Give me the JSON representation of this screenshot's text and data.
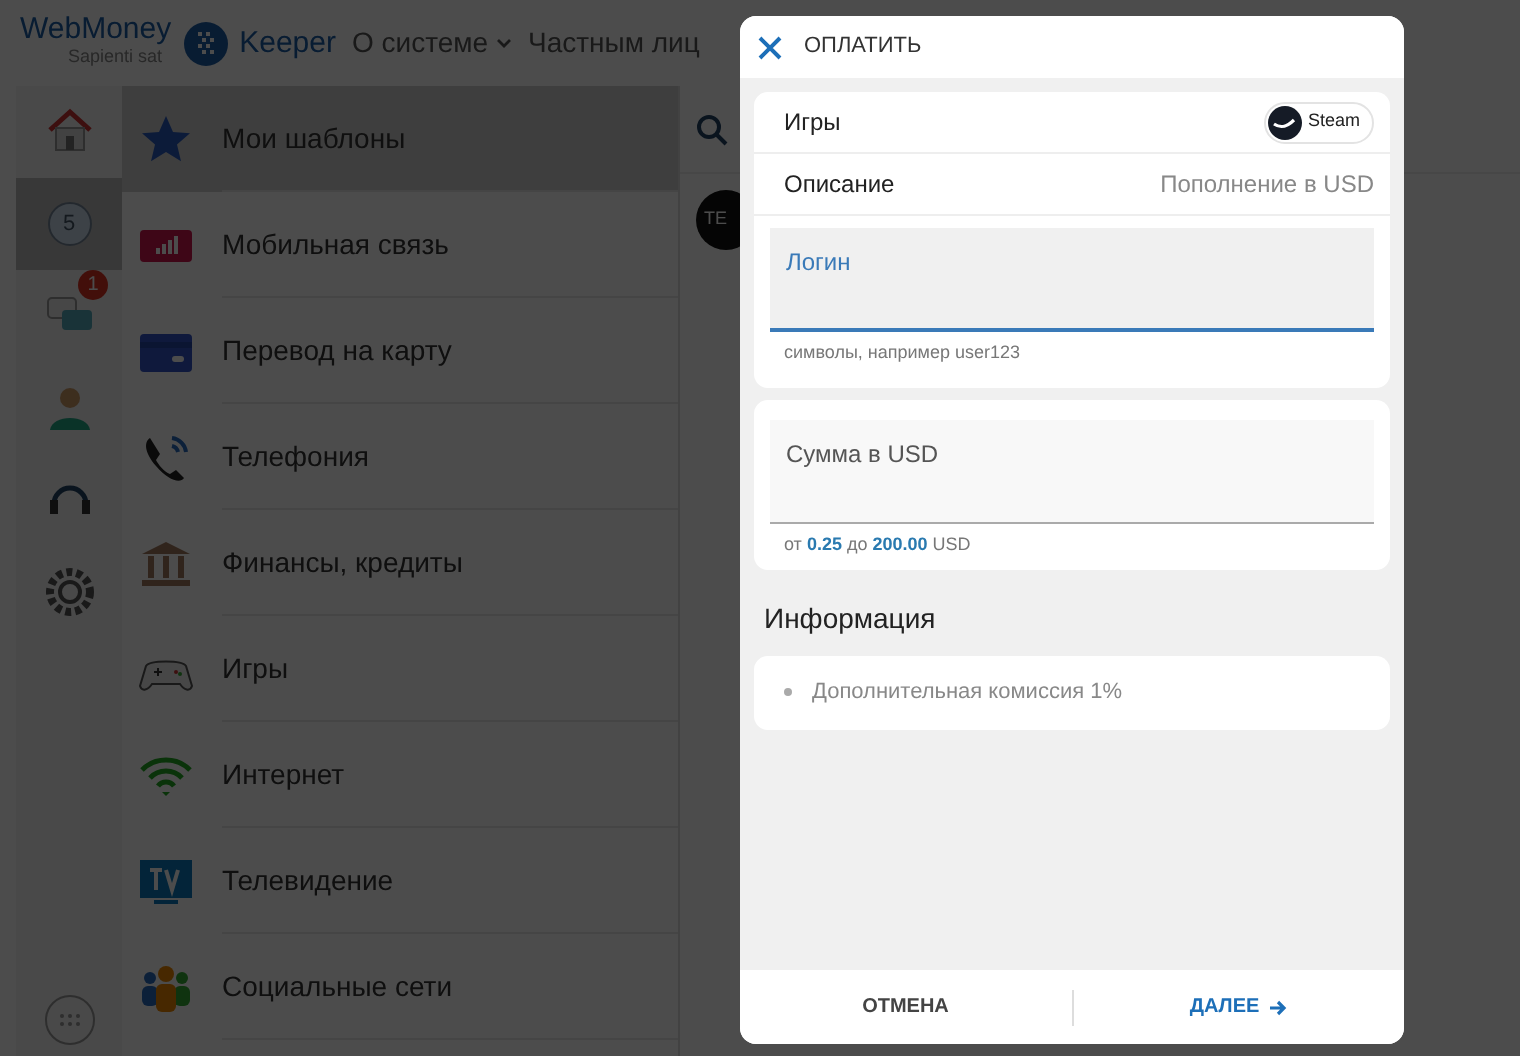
{
  "header": {
    "brand": "WebMoney",
    "tagline": "Sapienti sat",
    "product": "Keeper",
    "nav": [
      {
        "label": "О системе",
        "dropdown": true
      },
      {
        "label": "Частным лиц",
        "dropdown": false
      }
    ]
  },
  "rail": [
    {
      "selected": false
    },
    {
      "selected": true,
      "label": "5"
    },
    {
      "selected": false,
      "badge": "1"
    },
    {
      "selected": false
    },
    {
      "selected": false
    },
    {
      "selected": false
    }
  ],
  "categories": [
    {
      "label": "Мои шаблоны",
      "selected": true
    },
    {
      "label": "Мобильная связь",
      "selected": false
    },
    {
      "label": "Перевод на карту",
      "selected": false
    },
    {
      "label": "Телефония",
      "selected": false
    },
    {
      "label": "Финансы, кредиты",
      "selected": false
    },
    {
      "label": "Игры",
      "selected": false
    },
    {
      "label": "Интернет",
      "selected": false
    },
    {
      "label": "Телевидение",
      "selected": false
    },
    {
      "label": "Социальные сети",
      "selected": false
    }
  ],
  "side_panel": {
    "avatar_text": "TE"
  },
  "dialog": {
    "title": "ОПЛАТИТЬ",
    "rows": [
      {
        "label": "Игры",
        "kind": "chip",
        "value": "Steam"
      },
      {
        "label": "Описание",
        "kind": "text",
        "value": "Пополнение в USD"
      }
    ],
    "fields": [
      {
        "label": "Логин",
        "hint": "символы, например user123",
        "focused": true
      },
      {
        "label": "Сумма в USD",
        "hint": "от **0.25** до **200.00** USD",
        "focused": false
      }
    ],
    "info_title": "Информация",
    "info_items": [
      "Дополнительная комиссия 1%"
    ],
    "buttons": [
      {
        "label": "ОТМЕНА",
        "primary": false
      },
      {
        "label": "ДАЛЕЕ",
        "primary": true
      }
    ]
  }
}
